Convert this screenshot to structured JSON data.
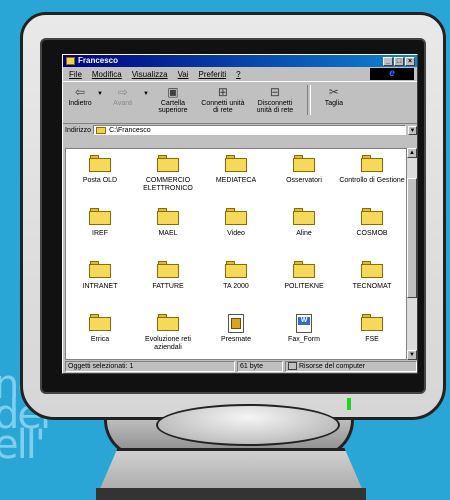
{
  "background_text": "ne\ndel\nell'",
  "window": {
    "title": "Francesco",
    "buttons": {
      "minimize": "_",
      "maximize": "□",
      "close": "×"
    }
  },
  "menu": [
    "File",
    "Modifica",
    "Visualizza",
    "Vai",
    "Preferiti",
    "?"
  ],
  "ie_logo": "e",
  "toolbar": {
    "back": {
      "icon": "⇦",
      "label": "Indietro"
    },
    "forward": {
      "icon": "⇨",
      "label": "Avanti"
    },
    "up": {
      "icon": "▣",
      "label": "Cartella\nsuperiore"
    },
    "connect": {
      "icon": "⊞",
      "label": "Connetti unità\ndi rete"
    },
    "disconnect": {
      "icon": "⊟",
      "label": "Disconnetti\nunità di rete"
    },
    "cut": {
      "icon": "✂",
      "label": "Taglia"
    }
  },
  "address": {
    "label": "Indirizzo",
    "value": "C:\\Francesco"
  },
  "items": [
    {
      "name": "Posta OLD",
      "type": "folder"
    },
    {
      "name": "COMMERCIO ELETTRONICO",
      "type": "folder"
    },
    {
      "name": "MEDIATECA",
      "type": "folder"
    },
    {
      "name": "Osservatori",
      "type": "folder"
    },
    {
      "name": "Controllo di Gestione",
      "type": "folder"
    },
    {
      "name": "IREF",
      "type": "folder"
    },
    {
      "name": "MAEL",
      "type": "folder"
    },
    {
      "name": "Video",
      "type": "folder"
    },
    {
      "name": "Aline",
      "type": "folder"
    },
    {
      "name": "COSMOB",
      "type": "folder"
    },
    {
      "name": "INTRANET",
      "type": "folder"
    },
    {
      "name": "FATTURE",
      "type": "folder"
    },
    {
      "name": "TA 2000",
      "type": "folder"
    },
    {
      "name": "POLITEKNE",
      "type": "folder"
    },
    {
      "name": "TECNOMAT",
      "type": "folder"
    },
    {
      "name": "Errica",
      "type": "folder"
    },
    {
      "name": "Evoluzione reti aziendali",
      "type": "folder"
    },
    {
      "name": "Presmate",
      "type": "ppt"
    },
    {
      "name": "Fax_Form",
      "type": "word"
    },
    {
      "name": "FSE",
      "type": "folder"
    }
  ],
  "status": {
    "selected": "Oggetti selezionati: 1",
    "size": "61 byte",
    "location": "Risorse del computer"
  }
}
